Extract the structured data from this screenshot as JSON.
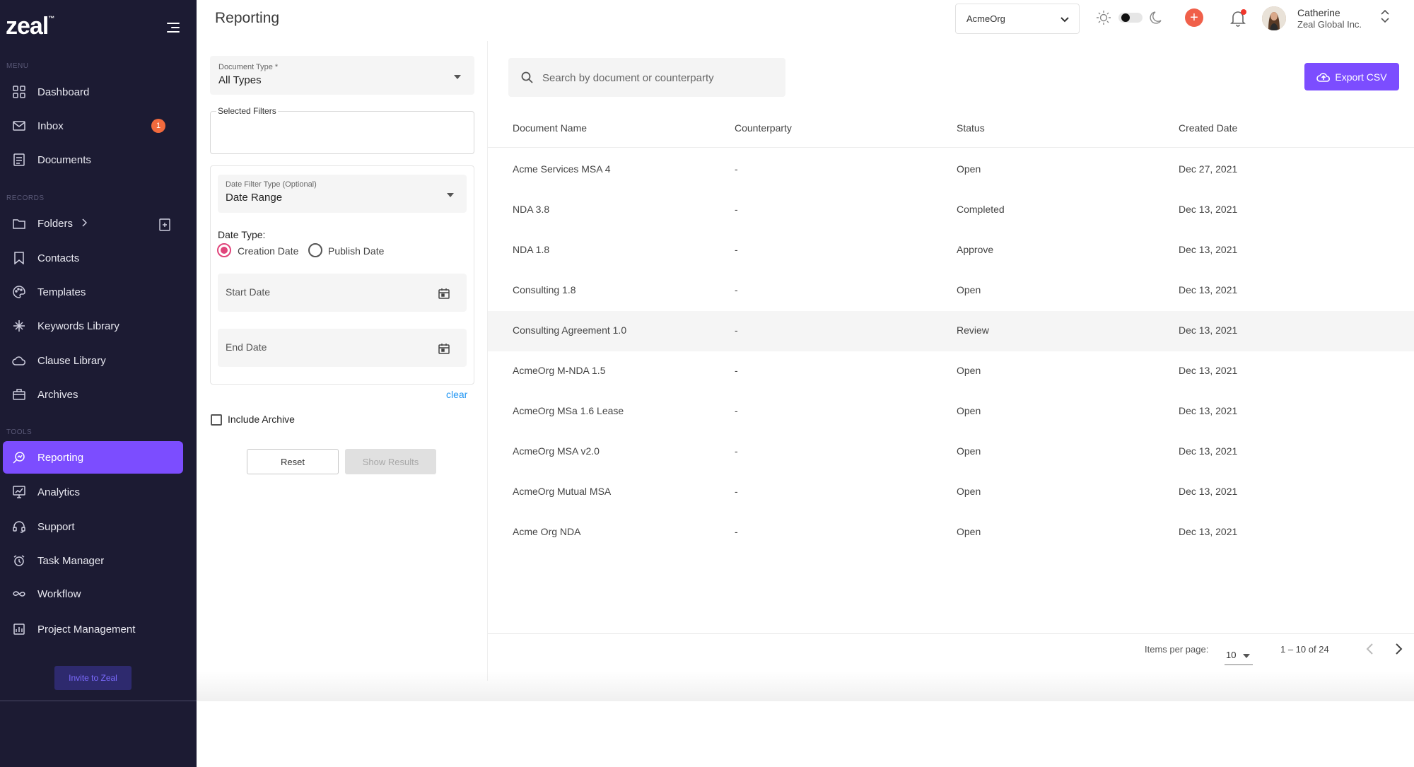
{
  "brand": {
    "logo": "zeal",
    "accent": "#7c4dff"
  },
  "sidebar": {
    "sections": {
      "menu": "MENU",
      "records": "RECORDS",
      "tools": "TOOLS"
    },
    "items": [
      {
        "label": "Dashboard",
        "icon": "grid-icon"
      },
      {
        "label": "Inbox",
        "icon": "mail-icon",
        "badge": "1"
      },
      {
        "label": "Documents",
        "icon": "document-icon"
      },
      {
        "label": "Folders",
        "icon": "folder-icon"
      },
      {
        "label": "Contacts",
        "icon": "bookmark-icon"
      },
      {
        "label": "Templates",
        "icon": "palette-icon"
      },
      {
        "label": "Keywords Library",
        "icon": "keywords-icon"
      },
      {
        "label": "Clause Library",
        "icon": "cloud-icon"
      },
      {
        "label": "Archives",
        "icon": "archive-icon"
      },
      {
        "label": "Reporting",
        "icon": "reporting-icon",
        "active": true
      },
      {
        "label": "Analytics",
        "icon": "analytics-icon"
      },
      {
        "label": "Support",
        "icon": "headset-icon"
      },
      {
        "label": "Task Manager",
        "icon": "alarm-icon"
      },
      {
        "label": "Workflow",
        "icon": "infinity-icon"
      },
      {
        "label": "Project Management",
        "icon": "project-icon"
      }
    ],
    "invite_label": "Invite to Zeal"
  },
  "header": {
    "title": "Reporting",
    "org_select": "AcmeOrg",
    "user": {
      "name": "Catherine",
      "org": "Zeal Global Inc."
    }
  },
  "filters": {
    "document_type": {
      "label": "Document Type *",
      "value": "All Types"
    },
    "selected_filters_label": "Selected Filters",
    "date_filter_type": {
      "label": "Date Filter Type (Optional)",
      "value": "Date Range"
    },
    "date_type_label": "Date Type:",
    "date_type_options": [
      "Creation Date",
      "Publish Date"
    ],
    "date_type_selected": "Creation Date",
    "start_date_placeholder": "Start Date",
    "end_date_placeholder": "End Date",
    "clear_label": "clear",
    "include_archive_label": "Include Archive",
    "reset_label": "Reset",
    "show_results_label": "Show Results"
  },
  "search": {
    "placeholder": "Search by document or counterparty"
  },
  "export_label": "Export CSV",
  "table": {
    "columns": [
      "Document Name",
      "Counterparty",
      "Status",
      "Created Date"
    ],
    "rows": [
      [
        "Acme Services MSA 4",
        "-",
        "Open",
        "Dec 27, 2021"
      ],
      [
        "NDA 3.8",
        "-",
        "Completed",
        "Dec 13, 2021"
      ],
      [
        "NDA 1.8",
        "-",
        "Approve",
        "Dec 13, 2021"
      ],
      [
        "Consulting 1.8",
        "-",
        "Open",
        "Dec 13, 2021"
      ],
      [
        "Consulting Agreement 1.0",
        "-",
        "Review",
        "Dec 13, 2021"
      ],
      [
        "AcmeOrg M-NDA 1.5",
        "-",
        "Open",
        "Dec 13, 2021"
      ],
      [
        "AcmeOrg MSa 1.6 Lease",
        "-",
        "Open",
        "Dec 13, 2021"
      ],
      [
        "AcmeOrg MSA v2.0",
        "-",
        "Open",
        "Dec 13, 2021"
      ],
      [
        "AcmeOrg Mutual MSA",
        "-",
        "Open",
        "Dec 13, 2021"
      ],
      [
        "Acme Org NDA",
        "-",
        "Open",
        "Dec 13, 2021"
      ]
    ],
    "highlighted_row": 4
  },
  "pagination": {
    "items_per_page_label": "Items per page:",
    "items_per_page": "10",
    "range": "1 – 10 of 24"
  }
}
